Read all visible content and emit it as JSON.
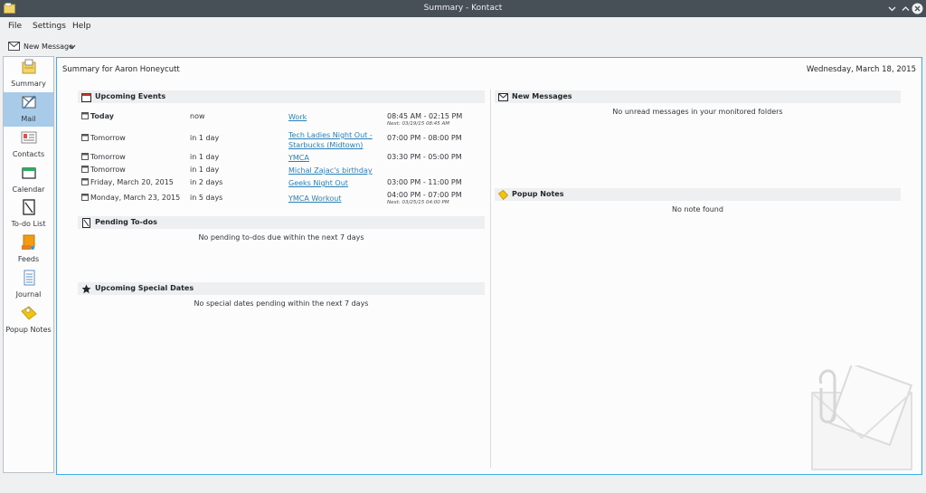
{
  "window": {
    "title": "Summary - Kontact"
  },
  "menu": {
    "file": "File",
    "settings": "Settings",
    "help": "Help"
  },
  "toolbar": {
    "new_message": "New Message"
  },
  "sidebar": {
    "items": [
      {
        "label": "Summary",
        "icon": "summary-icon"
      },
      {
        "label": "Mail",
        "icon": "mail-icon"
      },
      {
        "label": "Contacts",
        "icon": "contacts-icon"
      },
      {
        "label": "Calendar",
        "icon": "calendar-icon"
      },
      {
        "label": "To-do List",
        "icon": "todo-icon"
      },
      {
        "label": "Feeds",
        "icon": "feeds-icon"
      },
      {
        "label": "Journal",
        "icon": "journal-icon"
      },
      {
        "label": "Popup Notes",
        "icon": "notes-icon"
      }
    ],
    "active_index": 1
  },
  "summary": {
    "title": "Summary for Aaron Honeycutt",
    "date": "Wednesday, March 18, 2015"
  },
  "events": {
    "title": "Upcoming Events",
    "rows": [
      {
        "when": "Today",
        "rel": "now",
        "summary": "Work",
        "summary2": "",
        "time": "08:45 AM - 02:15 PM",
        "next": "Next: 03/19/15 08:45 AM"
      },
      {
        "when": "Tomorrow",
        "rel": "in 1 day",
        "summary": "Tech Ladies Night Out -",
        "summary2": "Starbucks (Midtown)",
        "time": "07:00 PM - 08:00 PM",
        "next": ""
      },
      {
        "when": "Tomorrow",
        "rel": "in 1 day",
        "summary": "YMCA",
        "summary2": "",
        "time": "03:30 PM - 05:00 PM",
        "next": ""
      },
      {
        "when": "Tomorrow",
        "rel": "in 1 day",
        "summary": "Michal Zajac's birthday",
        "summary2": "",
        "time": "",
        "next": ""
      },
      {
        "when": "Friday, March 20, 2015",
        "rel": "in 2 days",
        "summary": "Geeks Night Out",
        "summary2": "",
        "time": "03:00 PM - 11:00 PM",
        "next": ""
      },
      {
        "when": "Monday, March 23, 2015",
        "rel": "in 5 days",
        "summary": "YMCA Workout",
        "summary2": "",
        "time": "04:00 PM - 07:00 PM",
        "next": "Next: 03/25/15 04:00 PM"
      }
    ]
  },
  "todos": {
    "title": "Pending To-dos",
    "empty": "No pending to-dos due within the next 7 days"
  },
  "special": {
    "title": "Upcoming Special Dates",
    "empty": "No special dates pending within the next 7 days"
  },
  "messages": {
    "title": "New Messages",
    "empty": "No unread messages in your monitored folders"
  },
  "notes": {
    "title": "Popup Notes",
    "empty": "No note found"
  },
  "colors": {
    "accent": "#3daee9",
    "link": "#2980b9",
    "titlebar": "#475057",
    "selection": "#a8cbe9"
  }
}
